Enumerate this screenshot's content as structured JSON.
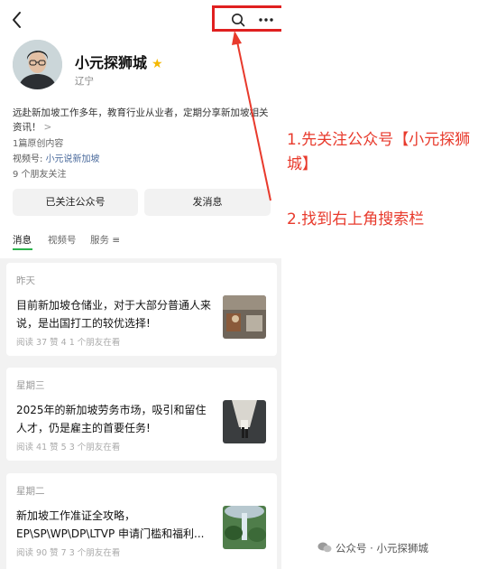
{
  "account": {
    "name": "小元探狮城",
    "location": "辽宁",
    "bio": "远赴新加坡工作多年，教育行业从业者，定期分享新加坡相关资讯！",
    "bio_arrow": ">",
    "original_count": "1篇原创内容",
    "channel_label": "视频号: ",
    "channel_name": "小元说新加坡",
    "friends_following": "9 个朋友关注"
  },
  "buttons": {
    "followed": "已关注公众号",
    "message": "发消息"
  },
  "tabs": [
    {
      "label": "消息"
    },
    {
      "label": "视频号"
    },
    {
      "label": "服务 ≡"
    }
  ],
  "articles": [
    {
      "day": "昨天",
      "title": "目前新加坡仓储业，对于大部分普通人来说，是出国打工的较优选择!",
      "meta": "阅读 37  赞 4  1 个朋友在看"
    },
    {
      "day": "星期三",
      "title": "2025年的新加坡劳务市场，吸引和留住人才，仍是雇主的首要任务!",
      "meta": "阅读 41  赞 5  3 个朋友在看"
    },
    {
      "day": "星期二",
      "title": "新加坡工作准证全攻略，EP\\SP\\WP\\DP\\LTVP 申请门槛和福利...",
      "meta": "阅读 90  赞 7  3 个朋友在看"
    }
  ],
  "annotations": {
    "step1": "1.先关注公众号【小元探狮城】",
    "step2": "2.找到右上角搜索栏"
  },
  "watermark": "公众号 · 小元探狮城",
  "colors": {
    "highlight_red": "#e02020",
    "annotation_red": "#e83a2c",
    "tab_green": "#2bb24c",
    "verified_star": "#f5b800"
  }
}
